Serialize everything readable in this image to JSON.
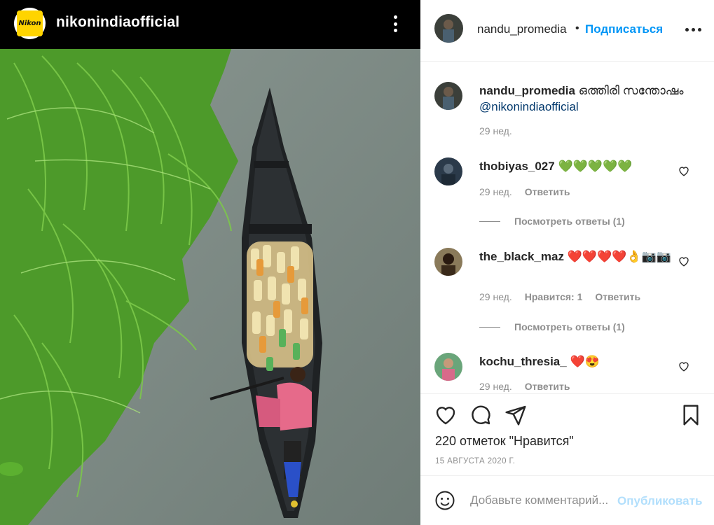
{
  "left_header": {
    "logo_text": "Nikon",
    "username": "nikonindiaofficial"
  },
  "right_header": {
    "username": "nandu_promedia",
    "separator": "•",
    "follow_label": "Подписаться"
  },
  "caption": {
    "username": "nandu_promedia",
    "text": " ഒത്തിരി സന്തോഷം ",
    "mention": "@nikonindiaofficial",
    "time": "29 нед."
  },
  "comments": [
    {
      "username": "thobiyas_027",
      "text": " 💚💚💚💚💚",
      "time": "29 нед.",
      "likes": "",
      "reply_label": "Ответить",
      "view_replies": "Посмотреть ответы (1)"
    },
    {
      "username": "the_black_maz",
      "text": " ❤️❤️❤️❤️👌📷📷",
      "time": "29 нед.",
      "likes": "Нравится: 1",
      "reply_label": "Ответить",
      "view_replies": "Посмотреть ответы (1)"
    },
    {
      "username": "kochu_thresia_",
      "text": " ❤️😍",
      "time": "29 нед.",
      "likes": "",
      "reply_label": "Ответить",
      "view_replies": ""
    }
  ],
  "post": {
    "likes_text": "220 отметок \"Нравится\"",
    "date_text": "15 АВГУСТА 2020 Г."
  },
  "add_comment": {
    "placeholder": "Добавьте комментарий...",
    "post_label": "Опубликовать"
  },
  "colors": {
    "accent": "#0095f6",
    "post_disabled": "#b2dffc",
    "secondary_text": "#8e8e8e",
    "primary_text": "#262626",
    "heart_green": "#2bbf2b",
    "heart_red": "#e0245e"
  },
  "icons": [
    "heart-icon",
    "comment-icon",
    "share-icon",
    "bookmark-icon",
    "emoji-icon",
    "more-icon"
  ]
}
